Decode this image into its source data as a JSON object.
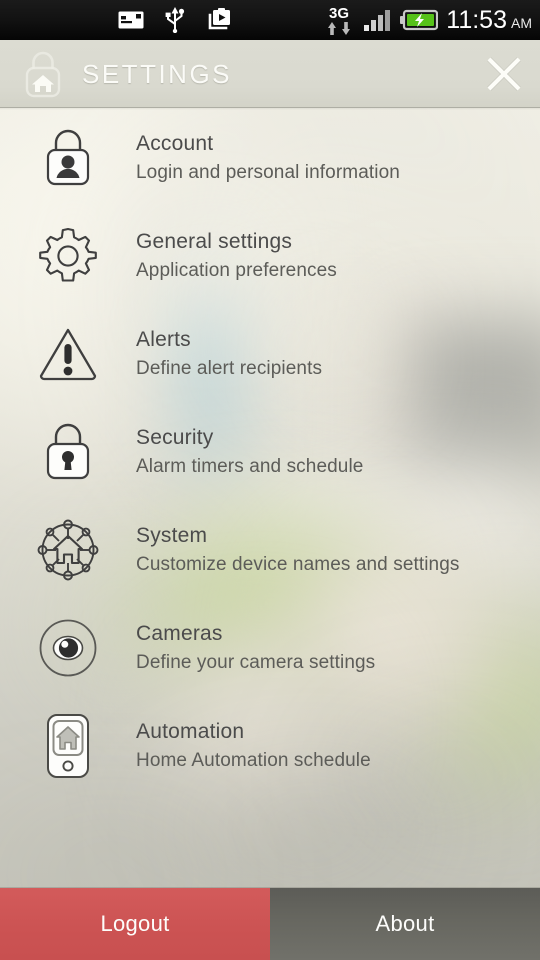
{
  "statusbar": {
    "time": "11:53",
    "ampm": "AM",
    "network": "3G",
    "icons": [
      "sim-card-icon",
      "usb-icon",
      "media-capture-icon",
      "network-3g-icon",
      "data-transfer-icon",
      "signal-bars-icon",
      "battery-charging-icon"
    ],
    "signal_bars_filled": 3,
    "signal_bars_total": 4,
    "battery_charging": true
  },
  "header": {
    "title": "SETTINGS",
    "logo_icon": "home-lock-logo-icon",
    "close_icon": "close-icon"
  },
  "menu": {
    "items": [
      {
        "id": "account",
        "icon": "lock-person-icon",
        "title": "Account",
        "subtitle": "Login and personal information"
      },
      {
        "id": "general-settings",
        "icon": "gear-icon",
        "title": "General settings",
        "subtitle": "Application preferences"
      },
      {
        "id": "alerts",
        "icon": "warning-triangle-icon",
        "title": "Alerts",
        "subtitle": "Define alert recipients"
      },
      {
        "id": "security",
        "icon": "padlock-keyhole-icon",
        "title": "Security",
        "subtitle": "Alarm timers and schedule"
      },
      {
        "id": "system",
        "icon": "home-network-icon",
        "title": "System",
        "subtitle": "Customize device names and settings"
      },
      {
        "id": "cameras",
        "icon": "eye-circle-icon",
        "title": "Cameras",
        "subtitle": "Define your camera settings"
      },
      {
        "id": "automation",
        "icon": "remote-home-icon",
        "title": "Automation",
        "subtitle": "Home Automation schedule"
      }
    ]
  },
  "bottombar": {
    "logout_label": "Logout",
    "about_label": "About"
  },
  "colors": {
    "logout_red": "#cc5353",
    "about_gray": "#66665f",
    "header_bg": "#d9d9cf",
    "title_text": "#4b4b4b",
    "subtitle_text": "#5c5c58",
    "icon_stroke": "#3f3f3f",
    "statusbar_bg": "#111111"
  }
}
